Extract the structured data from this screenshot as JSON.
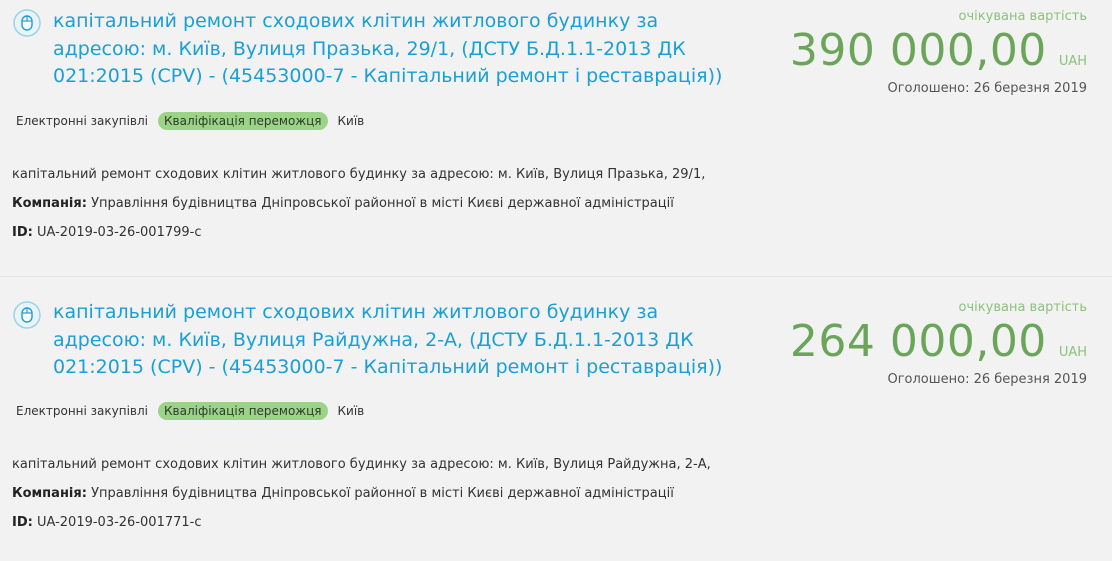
{
  "tenders": [
    {
      "title": "капітальний ремонт сходових клітин житлового будинку за адресою: м. Київ, Вулиця Празька, 29/1, (ДСТУ Б.Д.1.1-2013 ДК 021:2015 (CPV) - (45453000-7 - Капітальний ремонт і реставрація))",
      "price_label": "очікувана вартість",
      "price": "390 000,00",
      "currency": "UAH",
      "announced": "Оголошено: 26 березня 2019",
      "tag_type": "Електронні закупівлі",
      "tag_status": "Кваліфікація переможця",
      "tag_city": "Київ",
      "description": "капітальний ремонт сходових клітин житлового будинку за адресою: м. Київ, Вулиця Празька, 29/1,",
      "company_label": "Компанія:",
      "company": "Управління будівництва Дніпровської районної в місті Києві державної адміністрації",
      "id_label": "ID:",
      "id": "UA-2019-03-26-001799-c"
    },
    {
      "title": "капітальний ремонт сходових клітин житлового будинку за адресою: м. Київ, Вулиця Райдужна, 2-А, (ДСТУ Б.Д.1.1-2013 ДК 021:2015 (CPV) - (45453000-7 - Капітальний ремонт і реставрація))",
      "price_label": "очікувана вартість",
      "price": "264 000,00",
      "currency": "UAH",
      "announced": "Оголошено: 26 березня 2019",
      "tag_type": "Електронні закупівлі",
      "tag_status": "Кваліфікація переможця",
      "tag_city": "Київ",
      "description": "капітальний ремонт сходових клітин житлового будинку за адресою: м. Київ, Вулиця Райдужна, 2-А,",
      "company_label": "Компанія:",
      "company": "Управління будівництва Дніпровської районної в місті Києві державної адміністрації",
      "id_label": "ID:",
      "id": "UA-2019-03-26-001771-c"
    }
  ],
  "icon": "computer-mouse-icon",
  "colors": {
    "link": "#1a9fd9",
    "price": "#6ba55a",
    "status_tag": "#9bd487",
    "background": "#f2f2f2"
  }
}
